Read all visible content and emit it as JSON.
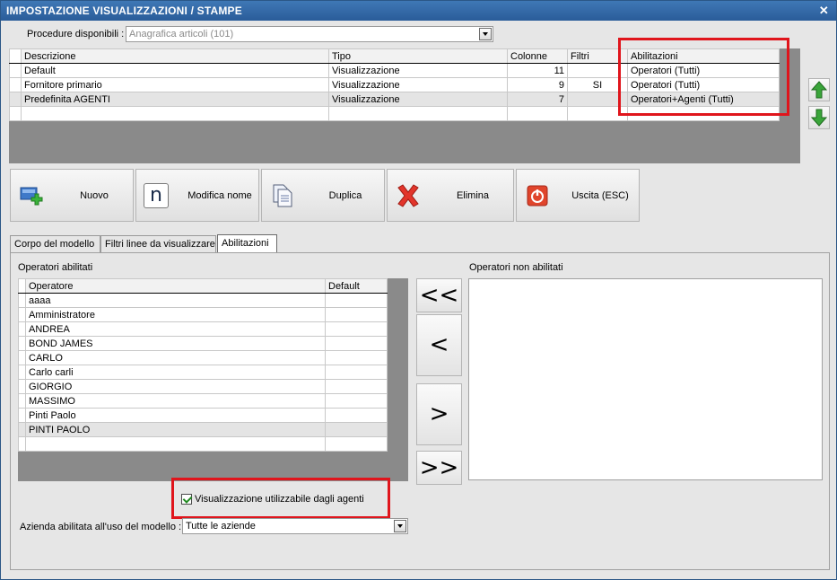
{
  "window": {
    "title": "IMPOSTAZIONE VISUALIZZAZIONI / STAMPE",
    "close_glyph": "✕"
  },
  "procedure": {
    "label": "Procedure disponibili :",
    "value": "Anagrafica articoli (101)"
  },
  "top_grid": {
    "columns": [
      "Descrizione",
      "Tipo",
      "Colonne",
      "Filtri",
      "Abilitazioni"
    ],
    "rows": [
      {
        "descrizione": "Default",
        "tipo": "Visualizzazione",
        "colonne": "11",
        "filtri": "",
        "abilitazioni": "Operatori (Tutti)"
      },
      {
        "descrizione": "Fornitore primario",
        "tipo": "Visualizzazione",
        "colonne": "9",
        "filtri": "SI",
        "abilitazioni": "Operatori (Tutti)"
      },
      {
        "descrizione": "Predefinita AGENTI",
        "tipo": "Visualizzazione",
        "colonne": "7",
        "filtri": "",
        "abilitazioni": "Operatori+Agenti (Tutti)"
      }
    ]
  },
  "toolbar": {
    "nuovo": "Nuovo",
    "modifica": "Modifica nome",
    "modifica_icon_letter": "n",
    "duplica": "Duplica",
    "elimina": "Elimina",
    "uscita": "Uscita (ESC)"
  },
  "tabs": [
    "Corpo del modello",
    "Filtri linee da visualizzare",
    "Abilitazioni"
  ],
  "abilitazioni": {
    "enabled_label": "Operatori abilitati",
    "disabled_label": "Operatori non abilitati",
    "columns": [
      "Operatore",
      "Default"
    ],
    "operators": [
      "aaaa",
      "Amministratore",
      "ANDREA",
      "BOND JAMES",
      "CARLO",
      "Carlo carli",
      "GIORGIO",
      "MASSIMO",
      "Pinti Paolo",
      "PINTI PAOLO"
    ],
    "move_buttons": [
      "<<",
      "<",
      ">",
      ">>"
    ],
    "agents_checkbox": "Visualizzazione utilizzabile dagli agenti",
    "azienda_label": "Azienda abilitata all'uso del modello :",
    "azienda_value": "Tutte le aziende"
  },
  "colors": {
    "title_bar": "#2f66a8",
    "highlight": "#e0151c",
    "arrow_green": "#3aa53a"
  }
}
